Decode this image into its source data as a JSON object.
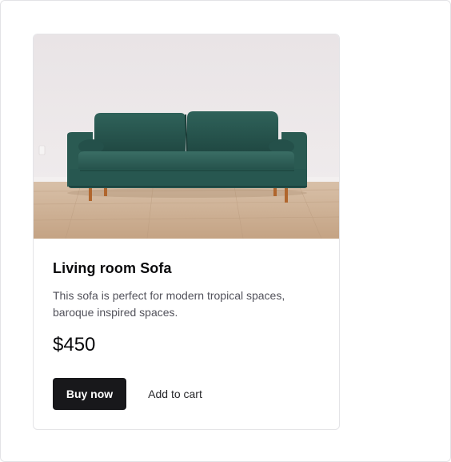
{
  "product": {
    "image_alt": "Green velvet sofa on a wooden floor",
    "title": "Living room Sofa",
    "description": "This sofa is perfect for modern tropical spaces, baroque inspired spaces.",
    "price": "$450",
    "buy_label": "Buy now",
    "cart_label": "Add to cart"
  },
  "colors": {
    "primary_button": "#18181b",
    "sofa": "#2f5e56",
    "wall": "#ece8ea",
    "floor": "#c9a98c"
  }
}
